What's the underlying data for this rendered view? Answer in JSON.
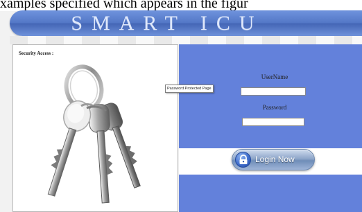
{
  "caption": {
    "text": "xamples specified which appears in the figur"
  },
  "header": {
    "title": "SMART ICU"
  },
  "left_panel": {
    "label": "Security Access :"
  },
  "tooltip": {
    "text": "Password Protected Page"
  },
  "login_form": {
    "username_label": "UserName",
    "password_label": "Password",
    "username_value": "",
    "password_value": "",
    "login_button_label": "Login Now"
  },
  "colors": {
    "banner_blue": "#5478c7",
    "panel_blue": "#6381db",
    "button_blue": "#8ea6c9"
  },
  "icons": {
    "login_icon": "lock-icon",
    "illustration": "keys-icon"
  }
}
